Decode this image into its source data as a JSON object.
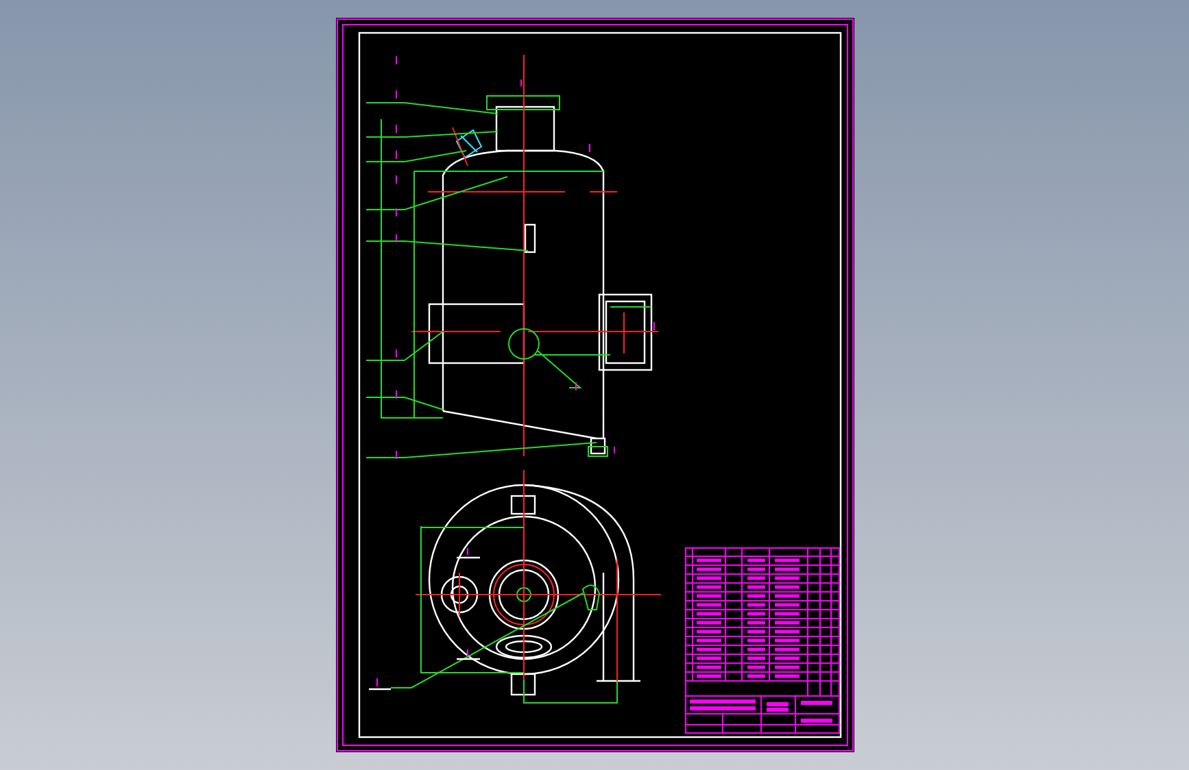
{
  "sheet": {
    "kind": "vessel-assembly"
  }
}
